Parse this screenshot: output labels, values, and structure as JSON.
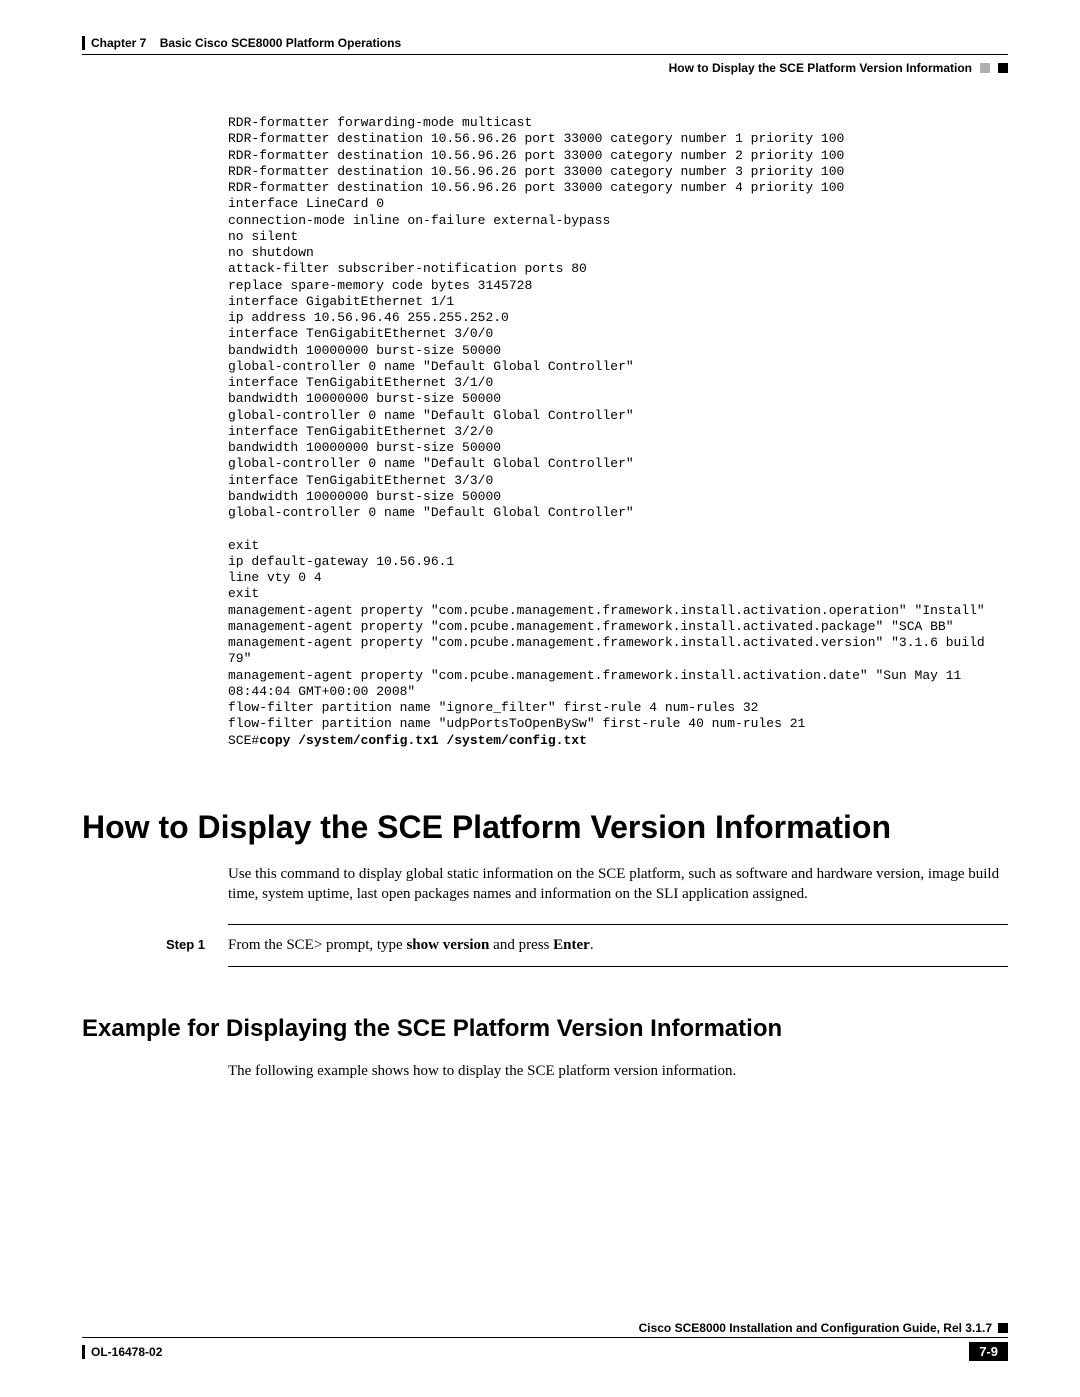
{
  "header": {
    "chapter_label": "Chapter 7",
    "chapter_title": "Basic Cisco SCE8000 Platform Operations",
    "section_title": "How to Display the SCE Platform Version Information"
  },
  "config": {
    "lines": "RDR-formatter forwarding-mode multicast\nRDR-formatter destination 10.56.96.26 port 33000 category number 1 priority 100\nRDR-formatter destination 10.56.96.26 port 33000 category number 2 priority 100\nRDR-formatter destination 10.56.96.26 port 33000 category number 3 priority 100\nRDR-formatter destination 10.56.96.26 port 33000 category number 4 priority 100\ninterface LineCard 0\nconnection-mode inline on-failure external-bypass\nno silent\nno shutdown\nattack-filter subscriber-notification ports 80\nreplace spare-memory code bytes 3145728\ninterface GigabitEthernet 1/1\nip address 10.56.96.46 255.255.252.0\ninterface TenGigabitEthernet 3/0/0\nbandwidth 10000000 burst-size 50000\nglobal-controller 0 name \"Default Global Controller\"\ninterface TenGigabitEthernet 3/1/0\nbandwidth 10000000 burst-size 50000\nglobal-controller 0 name \"Default Global Controller\"\ninterface TenGigabitEthernet 3/2/0\nbandwidth 10000000 burst-size 50000\nglobal-controller 0 name \"Default Global Controller\"\ninterface TenGigabitEthernet 3/3/0\nbandwidth 10000000 burst-size 50000\nglobal-controller 0 name \"Default Global Controller\"\n\nexit\nip default-gateway 10.56.96.1\nline vty 0 4\nexit\nmanagement-agent property \"com.pcube.management.framework.install.activation.operation\" \"Install\"\nmanagement-agent property \"com.pcube.management.framework.install.activated.package\" \"SCA BB\"\nmanagement-agent property \"com.pcube.management.framework.install.activated.version\" \"3.1.6 build 79\"\nmanagement-agent property \"com.pcube.management.framework.install.activation.date\" \"Sun May 11 08:44:04 GMT+00:00 2008\"\nflow-filter partition name \"ignore_filter\" first-rule 4 num-rules 32\nflow-filter partition name \"udpPortsToOpenBySw\" first-rule 40 num-rules 21",
    "last_prefix": "SCE#",
    "last_cmd": "copy /system/config.tx1 /system/config.txt"
  },
  "section1": {
    "heading": "How to Display the SCE Platform Version Information",
    "body": "Use this command to display global static information on the SCE platform, such as software and hardware version, image build time, system uptime, last open packages names and information on the SLI application assigned."
  },
  "step1": {
    "label": "Step 1",
    "prefix": "From the SCE> prompt, type ",
    "cmd": "show version",
    "mid": " and press ",
    "key": "Enter",
    "suffix": "."
  },
  "section2": {
    "heading": "Example for Displaying the SCE Platform Version Information",
    "body": "The following example shows how to display the SCE platform version information."
  },
  "footer": {
    "title": "Cisco SCE8000 Installation and Configuration Guide, Rel 3.1.7",
    "doc_id": "OL-16478-02",
    "page": "7-9"
  }
}
